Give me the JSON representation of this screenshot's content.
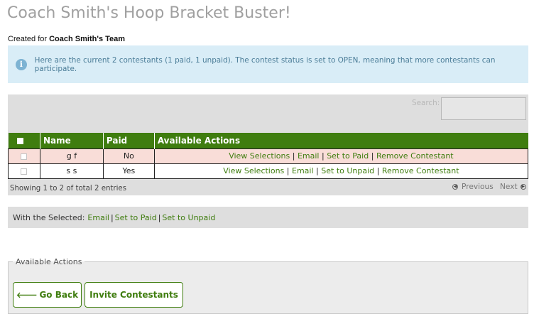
{
  "page": {
    "title": "Coach Smith's Hoop Bracket Buster!",
    "created_for_prefix": "Created for",
    "created_for_team": "Coach Smith's Team"
  },
  "info": {
    "icon": "info-icon",
    "text": "Here are the current 2 contestants (1 paid, 1 unpaid). The contest status is set to OPEN, meaning that more contestants can participate."
  },
  "search": {
    "label": "Search:",
    "value": ""
  },
  "table": {
    "headers": {
      "name": "Name",
      "paid": "Paid",
      "actions": "Available Actions"
    },
    "rows": [
      {
        "name": "g f",
        "paid": "No",
        "actions": [
          "View Selections",
          "Email",
          "Set to Paid",
          "Remove Contestant"
        ]
      },
      {
        "name": "s s",
        "paid": "Yes",
        "actions": [
          "View Selections",
          "Email",
          "Set to Unpaid",
          "Remove Contestant"
        ]
      }
    ],
    "separator": "|",
    "showing": "Showing 1 to 2 of total 2 entries",
    "pager": {
      "previous": "Previous",
      "next": "Next"
    }
  },
  "bulk": {
    "label": "With the Selected:",
    "actions": [
      "Email",
      "Set to Paid",
      "Set to Unpaid"
    ]
  },
  "actions_panel": {
    "legend": "Available Actions",
    "go_back": "Go Back",
    "invite": "Invite Contestants"
  },
  "colors": {
    "accent": "#3f7d0f",
    "info_bg": "#d9edf7",
    "unpaid_row": "#f9ddd8"
  }
}
